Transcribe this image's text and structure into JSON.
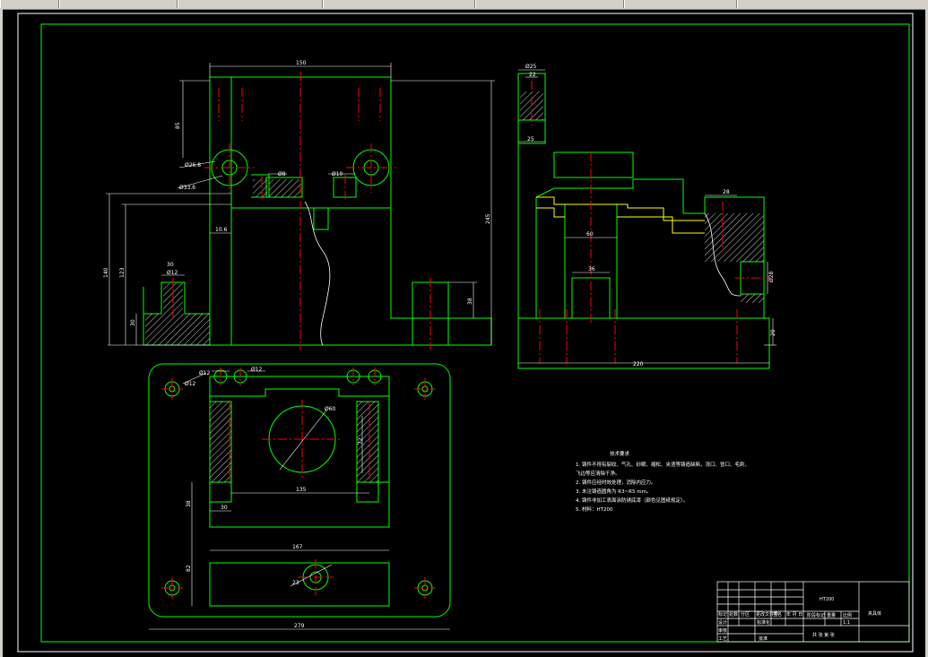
{
  "taskbar": {
    "tabs": [
      "",
      "",
      "",
      "",
      "",
      "",
      ""
    ]
  },
  "drawing": {
    "line_color": "#00ff00",
    "dim_color": "#ffffff",
    "center_color": "#ff0000",
    "hidden_color": "#ffff00",
    "dims_front": [
      "150",
      "85",
      "Ø26.8",
      "Ø33.6",
      "Ø8",
      "Ø10",
      "10.6",
      "245",
      "140",
      "123",
      "30",
      "Ø12",
      "38",
      "30"
    ],
    "dims_side": [
      "Ø25",
      "22",
      "25",
      "28",
      "60",
      "36",
      "Ø28",
      "20",
      "220"
    ],
    "dims_top": [
      "Ø12",
      "Ø12",
      "Ø12",
      "Ø60",
      "72",
      "135",
      "30",
      "38",
      "167",
      "82",
      "23",
      "279"
    ]
  },
  "notes": {
    "title": "技术要求",
    "lines": [
      "1. 铸件不得有裂纹、气孔、砂眼、缩松、夹渣等铸造缺陷，浇口、冒口、毛刺、",
      "   飞边等应清除干净。",
      "2. 铸件应经时效处理，消除内应力。",
      "3. 未注铸造圆角为 R3~R5 mm。",
      "4. 铸件非加工表面涂防锈底漆（颜色见图纸规定）。",
      "5. 材料：HT200"
    ]
  },
  "title_block": {
    "material": "HT200",
    "part_name": "夹具体",
    "scale": "1:1",
    "labels": [
      "标记",
      "处数",
      "分区",
      "更改文件号",
      "签名",
      "年 月 日",
      "设计",
      "标准化",
      "阶段标记",
      "重量",
      "比例",
      "审核",
      "工艺",
      "批准",
      "共 张 第 张"
    ]
  }
}
